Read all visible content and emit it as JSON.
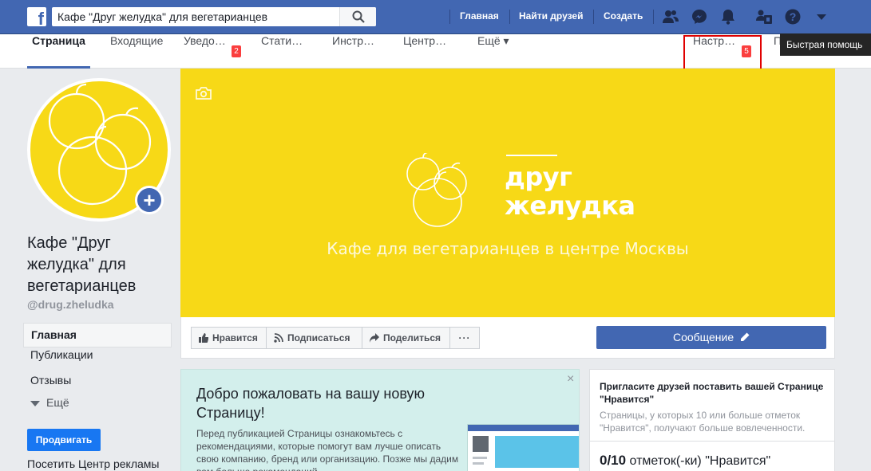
{
  "topbar": {
    "search_value": "Кафе \"Друг желудка\" для вегетарианцев",
    "nav": [
      "Главная",
      "Найти друзей",
      "Создать"
    ],
    "icons": [
      "friends-icon",
      "messenger-icon",
      "notifications-icon",
      "quick-help-page-icon",
      "help-icon",
      "chevron-down-icon"
    ],
    "brand_color": "#4267b2"
  },
  "tooltip": "Быстрая помощь",
  "page_tabs": {
    "items": [
      {
        "label": "Страница"
      },
      {
        "label": "Входящие"
      },
      {
        "label": "Уведо…",
        "badge": "2"
      },
      {
        "label": "Стати…"
      },
      {
        "label": "Инстр…"
      },
      {
        "label": "Центр…"
      },
      {
        "label": "Ещё ▾"
      },
      {
        "label": "Настр…",
        "badge": "5"
      },
      {
        "label": "По…"
      }
    ]
  },
  "page": {
    "name": "Кафе \"Друг желудка\" для вегетарианцев",
    "handle": "@drug.zheludka"
  },
  "left_nav": {
    "items": [
      "Главная",
      "Публикации",
      "Отзывы",
      "Ещё"
    ],
    "promote": "Продвигать",
    "ads_link": "Посетить Центр рекламы"
  },
  "cover": {
    "brand_line1": "друг",
    "brand_line2": "желудка",
    "tagline": "Кафе для вегетарианцев в центре Москвы",
    "color": "#f7d917"
  },
  "actions": {
    "like": "Нравится",
    "follow": "Подписаться",
    "share": "Поделиться",
    "more": "···",
    "message": "Сообщение"
  },
  "welcome": {
    "title": "Добро пожаловать на вашу новую Страницу!",
    "text": "Перед публикацией Страницы ознакомьтесь с рекомендациями, которые помогут вам лучше описать свою компанию, бренд или организацию. Позже мы дадим вам больше рекомендаций.",
    "close": "×"
  },
  "invite": {
    "title": "Пригласите друзей поставить вашей Странице \"Нравится\"",
    "text": "Страницы, у которых 10 или больше отметок \"Нравится\", получают больше вовлеченности.",
    "count": "0/10",
    "count_label": "отметок(-ки) \"Нравится\""
  }
}
